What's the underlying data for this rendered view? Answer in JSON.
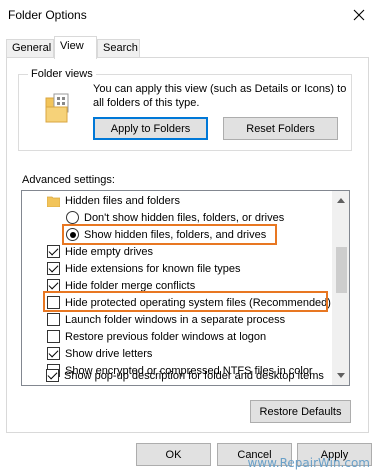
{
  "window": {
    "title": "Folder Options"
  },
  "tabs": [
    {
      "label": "General",
      "active": false
    },
    {
      "label": "View",
      "active": true
    },
    {
      "label": "Search",
      "active": false
    }
  ],
  "folder_views": {
    "label": "Folder views",
    "description": "You can apply this view (such as Details or Icons) to all folders of this type.",
    "apply_button": "Apply to Folders",
    "reset_button": "Reset Folders"
  },
  "advanced": {
    "label": "Advanced settings:",
    "items": [
      {
        "kind": "folder",
        "label": "Hidden files and folders",
        "indent": 1
      },
      {
        "kind": "radio",
        "checked": false,
        "label": "Don't show hidden files, folders, or drives",
        "indent": 2
      },
      {
        "kind": "radio",
        "checked": true,
        "label": "Show hidden files, folders, and drives",
        "indent": 2,
        "highlighted": true
      },
      {
        "kind": "check",
        "checked": true,
        "label": "Hide empty drives",
        "indent": 1
      },
      {
        "kind": "check",
        "checked": true,
        "label": "Hide extensions for known file types",
        "indent": 1
      },
      {
        "kind": "check",
        "checked": true,
        "label": "Hide folder merge conflicts",
        "indent": 1
      },
      {
        "kind": "check",
        "checked": false,
        "label": "Hide protected operating system files (Recommended)",
        "indent": 1,
        "highlighted": true
      },
      {
        "kind": "check",
        "checked": false,
        "label": "Launch folder windows in a separate process",
        "indent": 1
      },
      {
        "kind": "check",
        "checked": false,
        "label": "Restore previous folder windows at logon",
        "indent": 1
      },
      {
        "kind": "check",
        "checked": true,
        "label": "Show drive letters",
        "indent": 1
      },
      {
        "kind": "check",
        "checked": false,
        "label": "Show encrypted or compressed NTFS files in color",
        "indent": 1
      },
      {
        "kind": "check",
        "checked": true,
        "label": "Show pop-up description for folder and desktop items",
        "indent": 1
      }
    ],
    "restore_button": "Restore Defaults"
  },
  "footer": {
    "ok": "OK",
    "cancel": "Cancel",
    "apply": "Apply"
  },
  "watermark": "www.RepairWin.com",
  "colors": {
    "accent": "#0078d7",
    "highlight": "#e87722",
    "folder": "#f2c45a"
  }
}
